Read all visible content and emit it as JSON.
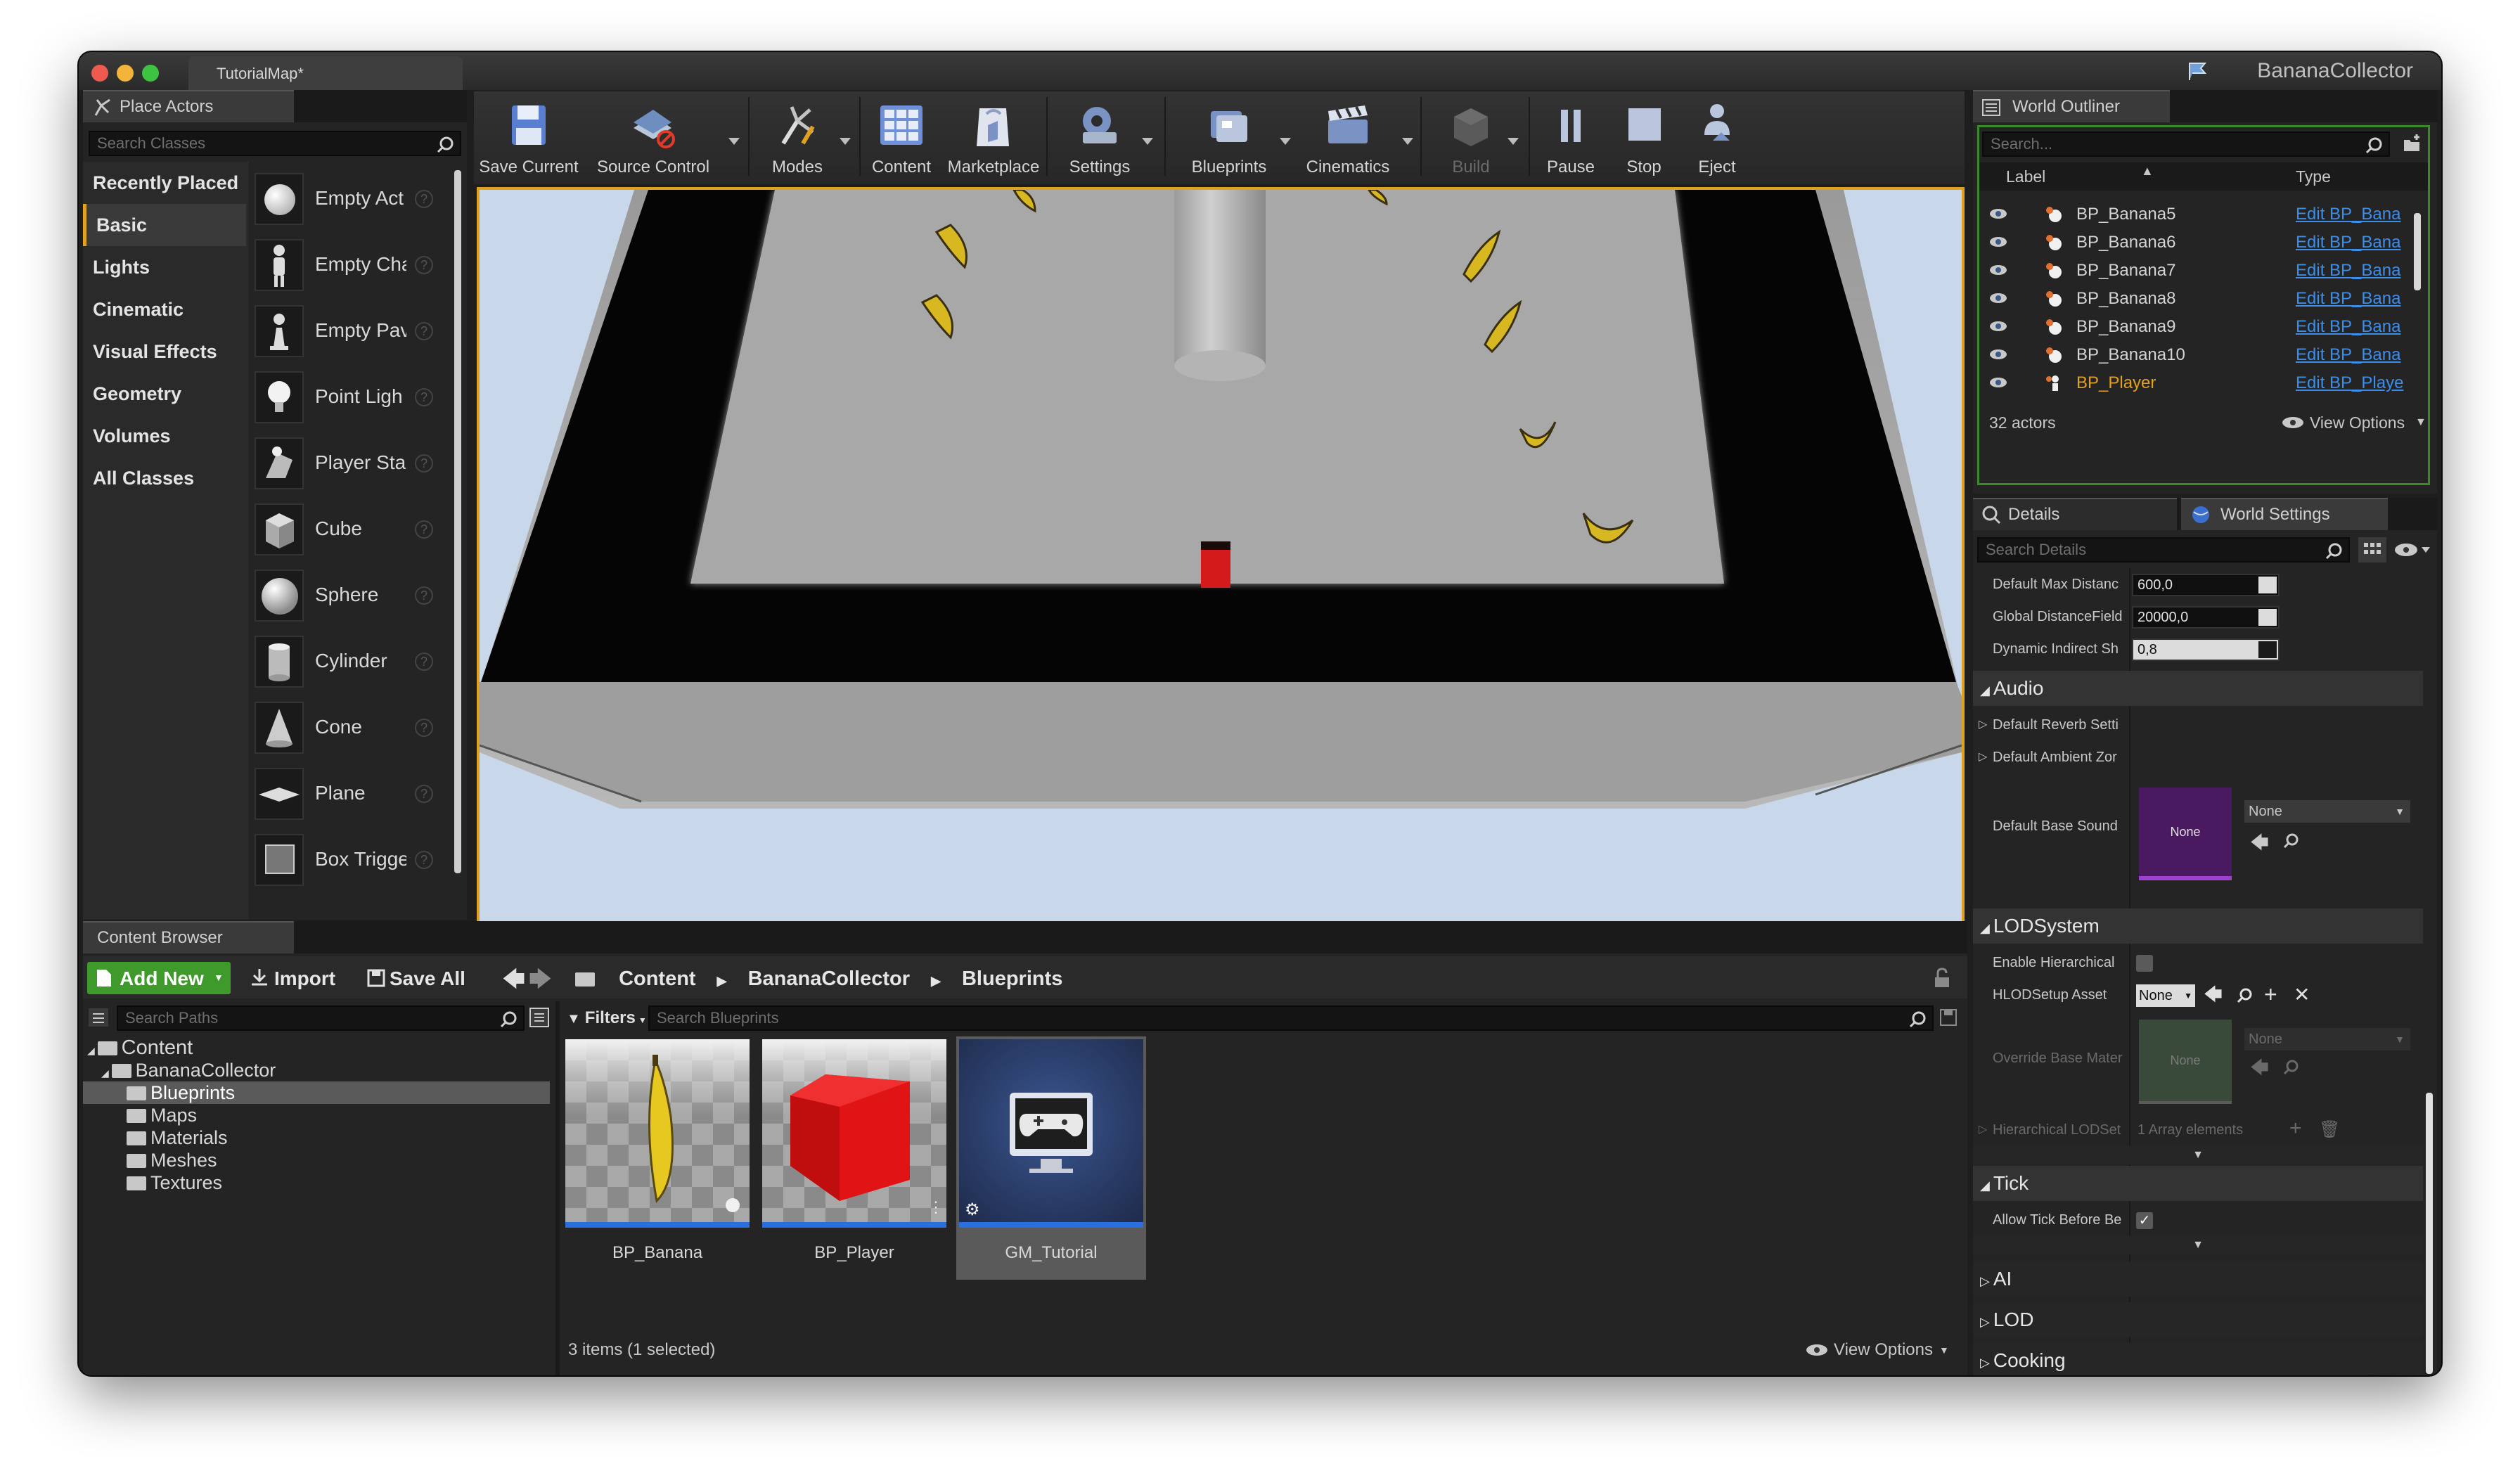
{
  "window": {
    "tab_title": "TutorialMap*",
    "app_title": "BananaCollector"
  },
  "place_actors": {
    "tab": "Place Actors",
    "search_placeholder": "Search Classes",
    "categories": [
      "Recently Placed",
      "Basic",
      "Lights",
      "Cinematic",
      "Visual Effects",
      "Geometry",
      "Volumes",
      "All Classes"
    ],
    "selected_category": "Basic",
    "items": [
      "Empty Act",
      "Empty Cha",
      "Empty Pav",
      "Point Ligh",
      "Player Sta",
      "Cube",
      "Sphere",
      "Cylinder",
      "Cone",
      "Plane",
      "Box Trigge"
    ]
  },
  "toolbar": {
    "buttons": [
      "Save Current",
      "Source Control",
      "Modes",
      "Content",
      "Marketplace",
      "Settings",
      "Blueprints",
      "Cinematics",
      "Build",
      "Pause",
      "Stop",
      "Eject"
    ]
  },
  "outliner": {
    "tab": "World Outliner",
    "search_placeholder": "Search...",
    "col_label": "Label",
    "col_type": "Type",
    "rows": [
      {
        "label": "BP_Banana5",
        "type": "Edit BP_Bana"
      },
      {
        "label": "BP_Banana6",
        "type": "Edit BP_Bana"
      },
      {
        "label": "BP_Banana7",
        "type": "Edit BP_Bana"
      },
      {
        "label": "BP_Banana8",
        "type": "Edit BP_Bana"
      },
      {
        "label": "BP_Banana9",
        "type": "Edit BP_Bana"
      },
      {
        "label": "BP_Banana10",
        "type": "Edit BP_Bana"
      },
      {
        "label": "BP_Player",
        "type": "Edit BP_Playe"
      }
    ],
    "count": "32 actors",
    "view_options": "View Options"
  },
  "details": {
    "tab_details": "Details",
    "tab_world": "World Settings",
    "search_placeholder": "Search Details",
    "props": [
      {
        "label": "Default Max Distanc",
        "value": "600,0"
      },
      {
        "label": "Global DistanceField",
        "value": "20000,0"
      },
      {
        "label": "Dynamic Indirect Sh",
        "value": "0,8"
      }
    ],
    "audio": {
      "title": "Audio",
      "reverb": "Default Reverb Setti",
      "ambient": "Default Ambient Zor",
      "base_sound": "Default Base Sound",
      "thumb": "None",
      "combo": "None"
    },
    "lod": {
      "title": "LODSystem",
      "enable": "Enable Hierarchical",
      "setup": "HLODSetup Asset",
      "setup_value": "None",
      "override": "Override Base Mater",
      "override_thumb": "None",
      "override_combo": "None",
      "hier": "Hierarchical LODSet",
      "array": "1 Array elements"
    },
    "tick": {
      "title": "Tick",
      "allow": "Allow Tick Before Be"
    },
    "ai": "AI",
    "lod_section": "LOD",
    "cooking": "Cooking"
  },
  "content_browser": {
    "tab": "Content Browser",
    "add_new": "Add New",
    "import": "Import",
    "save_all": "Save All",
    "breadcrumb": [
      "Content",
      "BananaCollector",
      "Blueprints"
    ],
    "search_paths": "Search Paths",
    "filters": "Filters",
    "search_blueprints": "Search Blueprints",
    "tree": [
      "Content",
      "BananaCollector",
      "Blueprints",
      "Maps",
      "Materials",
      "Meshes",
      "Textures"
    ],
    "assets": [
      "BP_Banana",
      "BP_Player",
      "GM_Tutorial"
    ],
    "status": "3 items (1 selected)",
    "view_options": "View Options"
  },
  "colors": {
    "accent": "#e0a020",
    "link": "#3d8ee8",
    "add_new": "#3e9a2a",
    "select": "#2a6fe0"
  }
}
